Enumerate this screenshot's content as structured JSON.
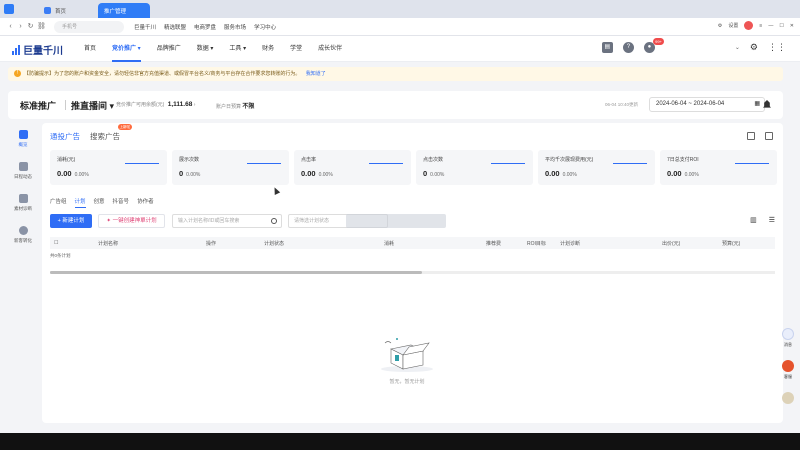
{
  "browser": {
    "tabs": [
      "首页",
      "推广管理"
    ],
    "url_placeholder": "手机号",
    "bookmarks": [
      "巨量千川",
      "精选联盟",
      "电商罗盘",
      "服务市场",
      "学习中心"
    ],
    "settings_label": "设置"
  },
  "app": {
    "logo_text": "巨量千川",
    "menu": [
      {
        "label": "首页"
      },
      {
        "label": "竞价推广 ▾"
      },
      {
        "label": "品牌推广"
      },
      {
        "label": "数据 ▾"
      },
      {
        "label": "工具 ▾"
      },
      {
        "label": "财务"
      },
      {
        "label": "学堂"
      },
      {
        "label": "成长伙伴"
      }
    ],
    "notification_count": "99+"
  },
  "notice": {
    "text": "【防骗提示】为了您的账户和资金安全，请勿轻信非官方充值渠道、或假冒平台名义/商务与平台存在合作要求您转账的行为。",
    "link": "我知道了"
  },
  "header": {
    "title": "标准推广",
    "subtitle": "推直播间 ▾",
    "balance_label": "竞价推广可用余额(元)",
    "balance_value": "1,111.68",
    "budget_label": "账户日预算",
    "budget_value": "不限",
    "refresh_time": "06-04 10:40更新",
    "date_start": "2024-06-04",
    "date_end": "2024-06-04"
  },
  "sidebar": {
    "items": [
      {
        "label": "概览"
      },
      {
        "label": "日程动态"
      },
      {
        "label": "素材诊断"
      },
      {
        "label": "新客转化"
      }
    ]
  },
  "main": {
    "ad_tabs": [
      {
        "label": "通投广告"
      },
      {
        "label": "搜索广告",
        "badge": "上新啦"
      }
    ],
    "metrics": [
      {
        "label": "消耗(元)",
        "value": "0.00",
        "pct": "0.00%"
      },
      {
        "label": "展示次数",
        "value": "0",
        "pct": "0.00%"
      },
      {
        "label": "点击率",
        "value": "0.00",
        "pct": "0.00%"
      },
      {
        "label": "点击次数",
        "value": "0",
        "pct": "0.00%"
      },
      {
        "label": "平均千次展现费用(元)",
        "value": "0.00",
        "pct": "0.00%"
      },
      {
        "label": "7日总支付ROI",
        "value": "0.00",
        "pct": "0.00%"
      }
    ],
    "subtabs": [
      "广告组",
      "计划",
      "创意",
      "抖音号",
      "协作者"
    ],
    "new_plan_button": "+ 新建计划",
    "quick_button": "一键创建神單计划",
    "search_placeholder": "输入计划名称/ID或回车搜索",
    "filter_placeholder": "请筛选计划状态",
    "table_headers": [
      "计划名称",
      "操作",
      "计划状态",
      "消耗",
      "推荐费",
      "ROI目标",
      "计划诊断",
      "出价(元)",
      "预算(元)"
    ],
    "table_total": "共0条计划",
    "empty_text": "暂无，暂无计划"
  },
  "floats": [
    {
      "label": "消息"
    },
    {
      "label": "客服"
    }
  ]
}
